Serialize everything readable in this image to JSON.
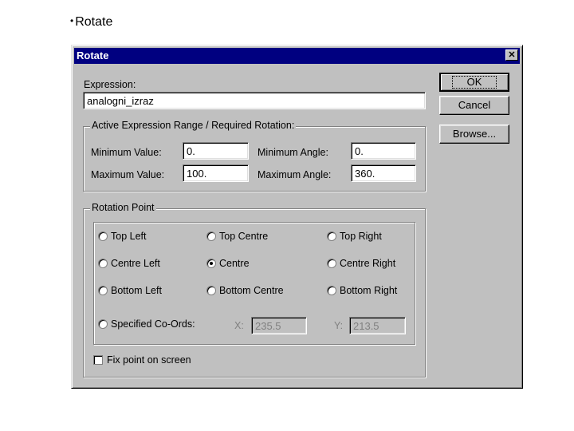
{
  "slide": {
    "bullet": "•",
    "title": "Rotate"
  },
  "dialog": {
    "title": "Rotate",
    "close_glyph": "✕",
    "expression_label": "Expression:",
    "expression_value": "analogni_izraz",
    "buttons": {
      "ok": "OK",
      "cancel": "Cancel",
      "browse": "Browse..."
    },
    "range_group": {
      "title": "Active Expression Range / Required Rotation:",
      "min_value_label": "Minimum Value:",
      "min_value": "0.",
      "max_value_label": "Maximum Value:",
      "max_value": "100.",
      "min_angle_label": "Minimum Angle:",
      "min_angle": "0.",
      "max_angle_label": "Maximum Angle:",
      "max_angle": "360."
    },
    "rotation_group": {
      "title": "Rotation Point",
      "options": [
        "Top Left",
        "Top Centre",
        "Top Right",
        "Centre Left",
        "Centre",
        "Centre Right",
        "Bottom Left",
        "Bottom Centre",
        "Bottom Right"
      ],
      "selected": "Centre",
      "specified_label": "Specified Co-Ords:",
      "x_label": "X:",
      "x_value": "235.5",
      "y_label": "Y:",
      "y_value": "213.5",
      "fix_point_label": "Fix point on screen"
    }
  }
}
